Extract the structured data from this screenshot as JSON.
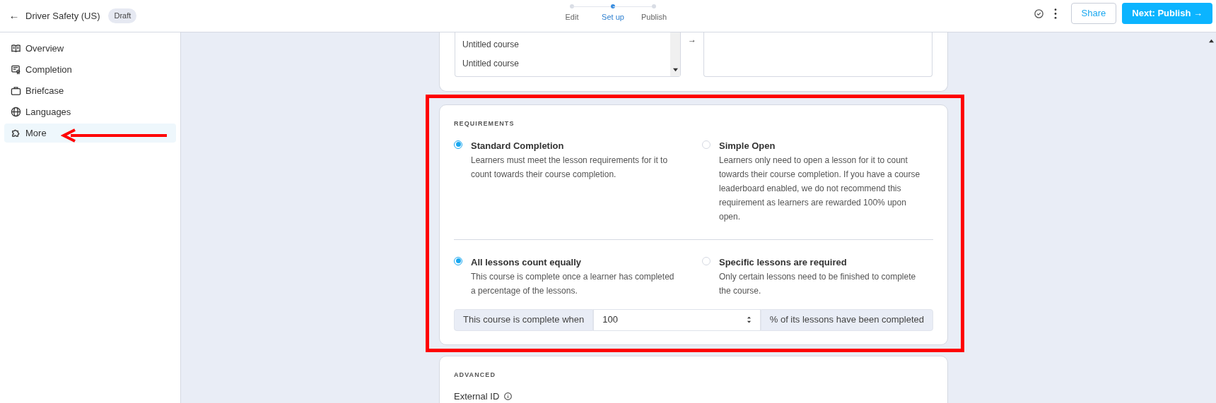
{
  "header": {
    "back_icon": "←",
    "title": "Driver Safety (US)",
    "badge": "Draft",
    "steps": [
      {
        "label": "Edit",
        "selected": false
      },
      {
        "label": "Set up",
        "selected": true
      },
      {
        "label": "Publish",
        "selected": false
      }
    ],
    "share": "Share",
    "next": "Next: Publish",
    "next_icon": "→"
  },
  "sidebar": {
    "items": [
      {
        "kind": "book",
        "label": "Overview",
        "selected": false
      },
      {
        "kind": "certificate",
        "label": "Completion",
        "selected": false
      },
      {
        "kind": "briefcase",
        "label": "Briefcase",
        "selected": false
      },
      {
        "kind": "globe",
        "label": "Languages",
        "selected": false
      },
      {
        "kind": "puzzle",
        "label": "More",
        "selected": true
      }
    ]
  },
  "course_picker": {
    "available": [
      "Untitled course",
      "Untitled course"
    ],
    "arrow": "→"
  },
  "requirements": {
    "heading": "REQUIREMENTS",
    "groups": [
      [
        {
          "title": "Standard Completion",
          "description": "Learners must meet the lesson requirements for it to count towards their course completion.",
          "selected": true
        },
        {
          "title": "Simple Open",
          "description": "Learners only need to open a lesson for it to count towards their course completion. If you have a course leaderboard enabled, we do not recommend this requirement as learners are rewarded 100% upon open.",
          "selected": false
        }
      ],
      [
        {
          "title": "All lessons count equally",
          "description": "This course is complete once a learner has completed a percentage of the lessons.",
          "selected": true
        },
        {
          "title": "Specific lessons are required",
          "description": "Only certain lessons need to be finished to complete the course.",
          "selected": false
        }
      ]
    ],
    "prefix": "This course is complete when",
    "value": "100",
    "suffix": "% of its lessons have been completed"
  },
  "advanced": {
    "heading": "ADVANCED",
    "field_label": "External ID"
  },
  "annotations": {
    "highlight_box": true,
    "arrow": true
  }
}
